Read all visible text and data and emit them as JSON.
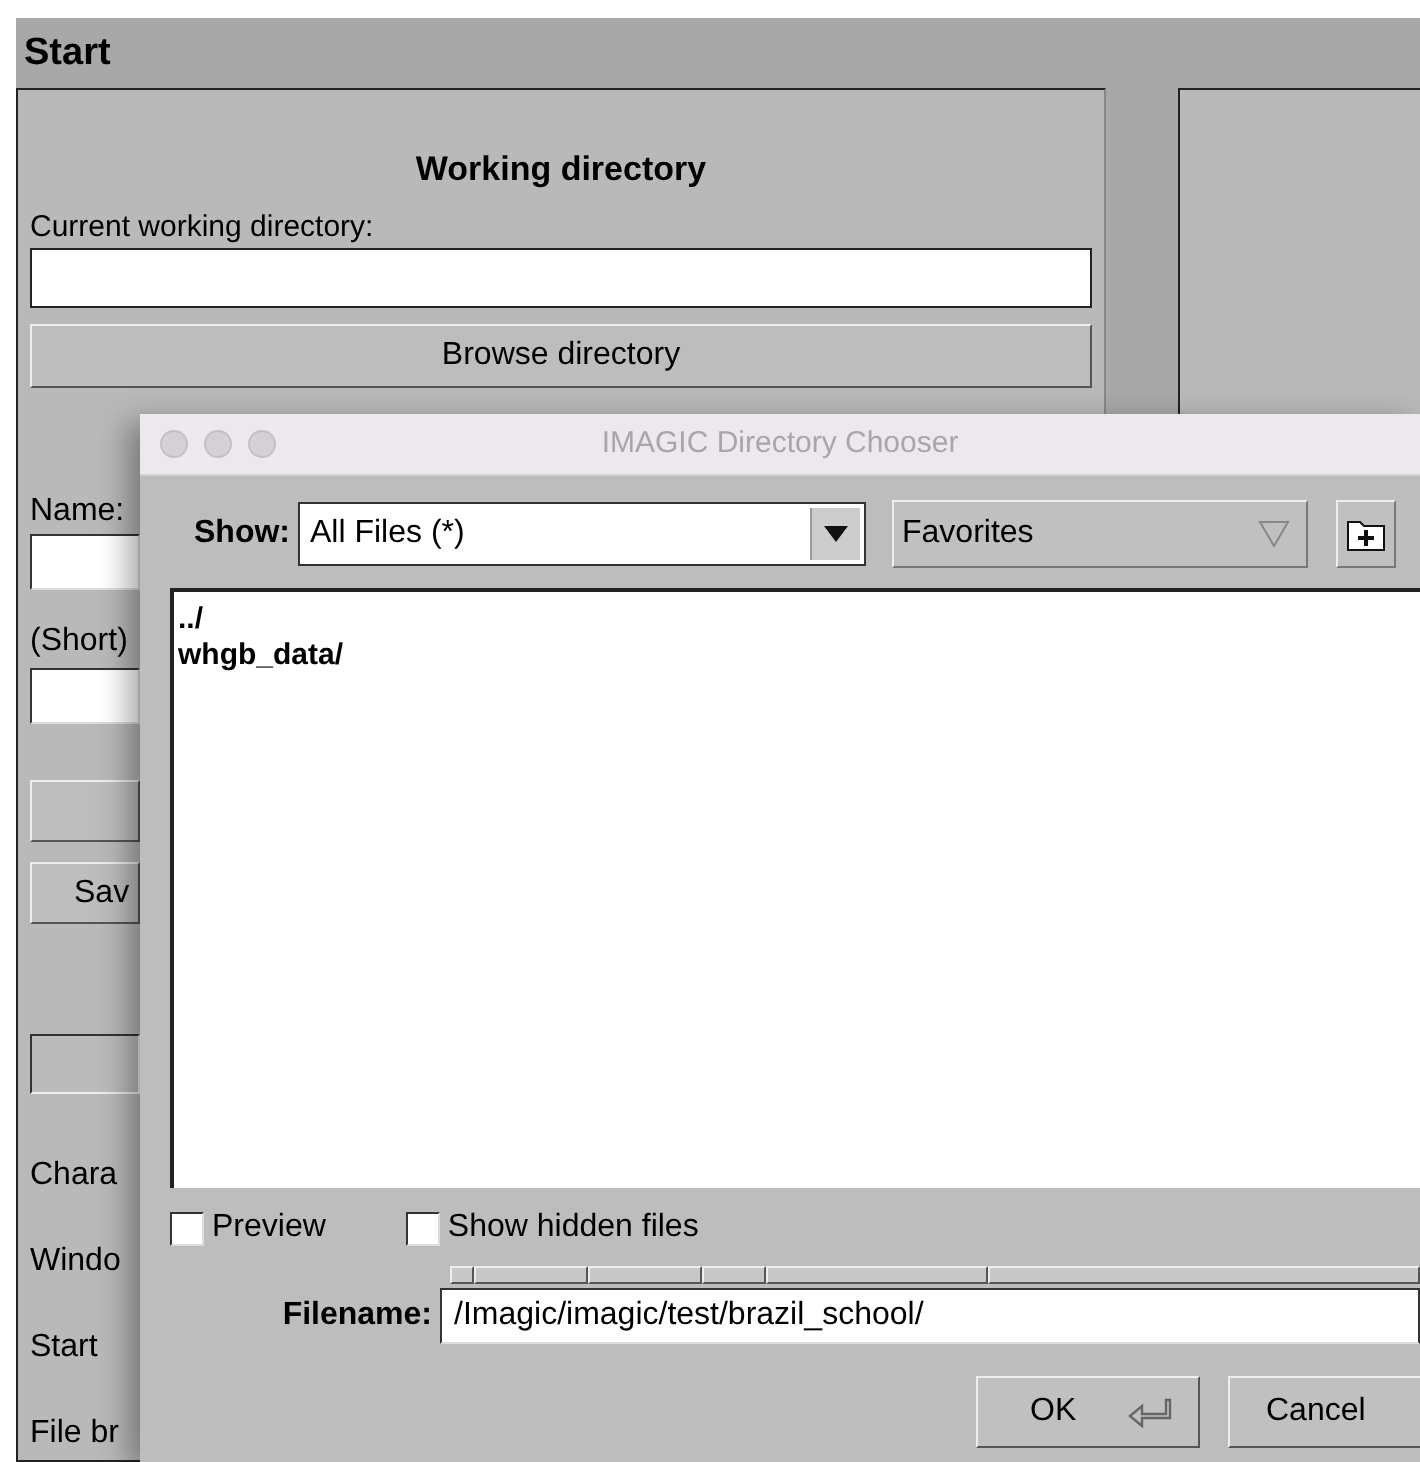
{
  "window": {
    "title": "Start"
  },
  "working_directory": {
    "heading": "Working directory",
    "label": "Current working directory:",
    "button": "Browse directory"
  },
  "left_column": [
    {
      "kind": "label",
      "text": "Name:"
    },
    {
      "kind": "field"
    },
    {
      "kind": "label",
      "text": "(Short)"
    },
    {
      "kind": "field"
    },
    {
      "kind": "button"
    },
    {
      "kind": "button",
      "text": "Sav"
    },
    {
      "kind": "field"
    },
    {
      "kind": "label",
      "text": "Chara"
    },
    {
      "kind": "label",
      "text": "Windo"
    },
    {
      "kind": "label",
      "text": "Start"
    },
    {
      "kind": "label",
      "text": "File br"
    }
  ],
  "dialog": {
    "title": "IMAGIC Directory Chooser",
    "show_label": "Show:",
    "filter": "All Files (*)",
    "favorites": "Favorites",
    "files": [
      {
        "name": "../"
      },
      {
        "name": "whgb_data/"
      }
    ],
    "options": [
      {
        "label": "Preview",
        "checked": false
      },
      {
        "label": "Show hidden files",
        "checked": false
      }
    ],
    "filename_label": "Filename:",
    "filename": "/Imagic/imagic/test/brazil_school/",
    "buttons": [
      {
        "label": "OK",
        "kind": "default"
      },
      {
        "label": "Cancel",
        "kind": "plain"
      }
    ]
  }
}
